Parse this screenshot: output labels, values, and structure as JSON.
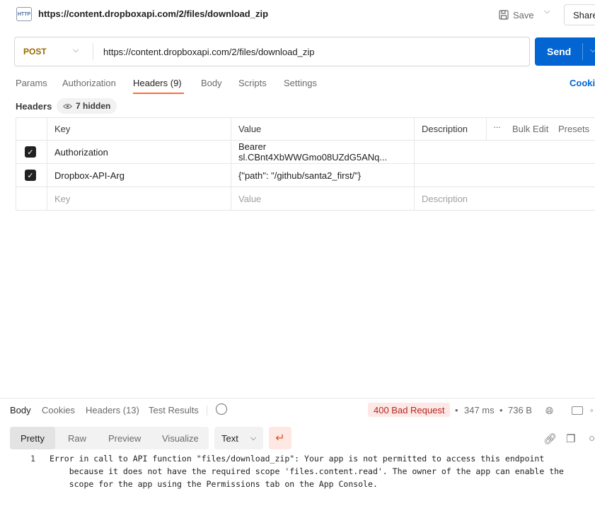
{
  "request": {
    "title": "https://content.dropboxapi.com/2/files/download_zip",
    "http_badge": "HTTP",
    "save_label": "Save",
    "share_label": "Share",
    "method": "POST",
    "url": "https://content.dropboxapi.com/2/files/download_zip",
    "send_label": "Send"
  },
  "tabs": [
    {
      "label": "Params"
    },
    {
      "label": "Authorization"
    },
    {
      "label": "Headers (9)",
      "active": true
    },
    {
      "label": "Body"
    },
    {
      "label": "Scripts"
    },
    {
      "label": "Settings"
    }
  ],
  "cookies_label": "Cookie",
  "headers_section": {
    "label": "Headers",
    "hidden_label": "7 hidden",
    "bulk_edit": "Bulk Edit",
    "presets": "Presets",
    "columns": {
      "key": "Key",
      "value": "Value",
      "description": "Description"
    },
    "rows": [
      {
        "checked": true,
        "key": "Authorization",
        "value": "Bearer sl.CBnt4XbWWGmo08UZdG5ANq...",
        "description": ""
      },
      {
        "checked": true,
        "key": "Dropbox-API-Arg",
        "value": "{\"path\": \"/github/santa2_first/\"}",
        "description": ""
      }
    ],
    "placeholder": {
      "key": "Key",
      "value": "Value",
      "description": "Description"
    }
  },
  "response": {
    "tabs": [
      {
        "label": "Body",
        "active": true
      },
      {
        "label": "Cookies"
      },
      {
        "label": "Headers (13)"
      },
      {
        "label": "Test Results"
      }
    ],
    "status": "400 Bad Request",
    "time": "347 ms",
    "size": "736 B",
    "view_modes": [
      "Pretty",
      "Raw",
      "Preview",
      "Visualize"
    ],
    "format": "Text",
    "line_number": "1",
    "body_lines": [
      "Error in call to API function \"files/download_zip\": Your app is not permitted to access this endpoint",
      "    because it does not have the required scope 'files.content.read'. The owner of the app can enable the",
      "    scope for the app using the Permissions tab on the App Console."
    ]
  }
}
